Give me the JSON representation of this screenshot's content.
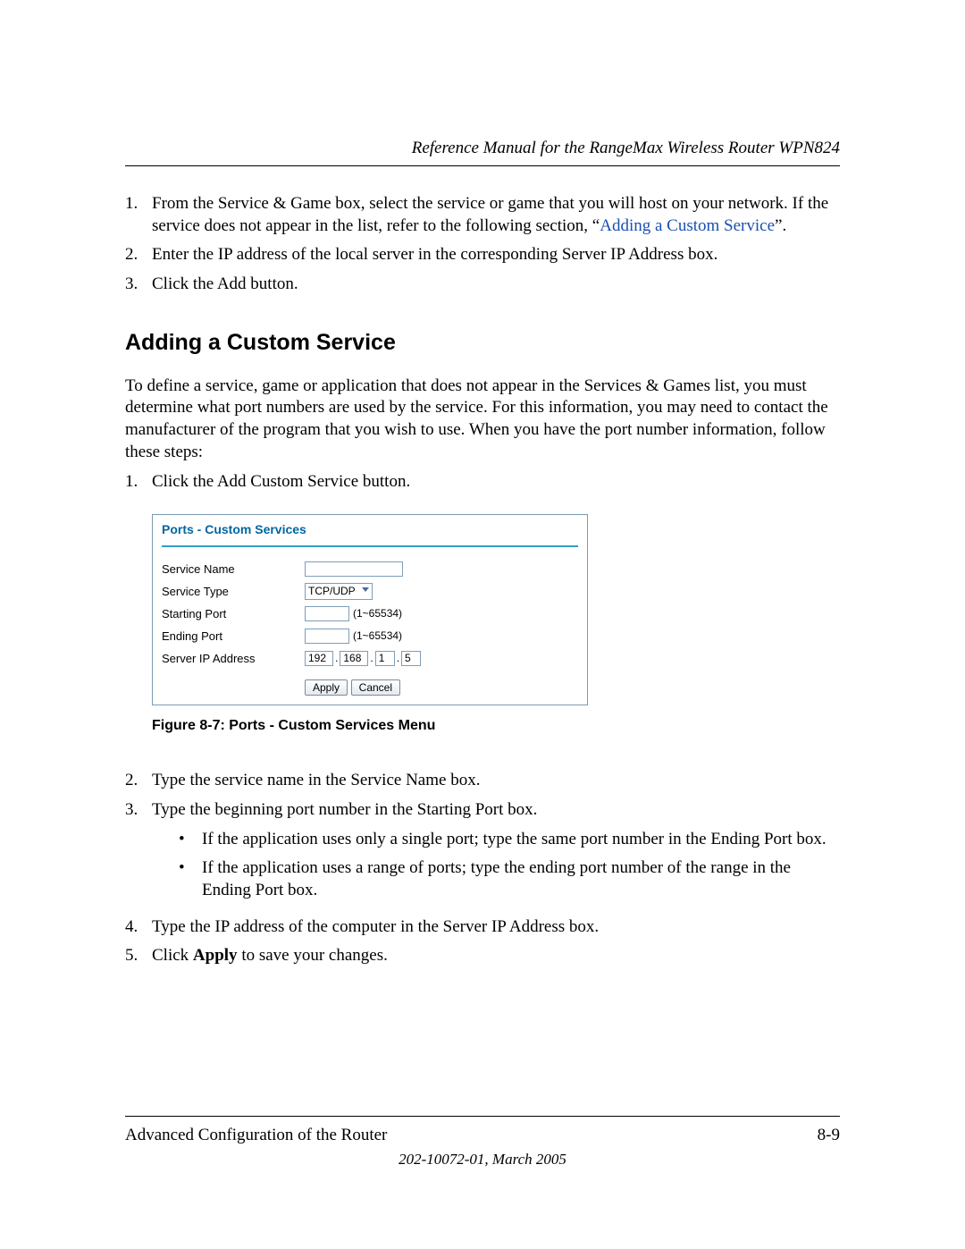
{
  "header": {
    "title": "Reference Manual for the RangeMax Wireless Router WPN824"
  },
  "list_a": {
    "item1_prefix": "From the Service & Game box, select the service or game that you will host on your network. If the service does not appear in the list, refer to the following section, “",
    "item1_link": "Adding a Custom Service",
    "item1_suffix": "”.",
    "item2": "Enter the IP address of the local server in the corresponding Server IP Address box.",
    "item3": "Click the Add button."
  },
  "section_heading": "Adding a Custom Service",
  "para1": "To define a service, game or application that does not appear in the Services & Games list, you must determine what port numbers are used by the service. For this information, you may need to contact the manufacturer of the program that you wish to use. When you have the port number information, follow these steps:",
  "list_b": {
    "item1": "Click the Add Custom Service button."
  },
  "figure": {
    "panel_title": "Ports - Custom Services",
    "labels": {
      "service_name": "Service Name",
      "service_type": "Service Type",
      "starting_port": "Starting Port",
      "ending_port": "Ending Port",
      "server_ip": "Server IP Address"
    },
    "values": {
      "service_name": "",
      "service_type": "TCP/UDP",
      "starting_port": "",
      "ending_port": "",
      "port_hint": "(1~65534)",
      "ip": {
        "a": "192",
        "b": "168",
        "c": "1",
        "d": "5"
      }
    },
    "buttons": {
      "apply": "Apply",
      "cancel": "Cancel"
    },
    "caption": "Figure 8-7:  Ports - Custom Services Menu"
  },
  "list_c": {
    "item2": "Type the service name in the Service Name box.",
    "item3": "Type the beginning port number in the Starting Port box.",
    "bullet1": "If the application uses only a single port; type the same port number in the Ending Port box.",
    "bullet2": "If the application uses a range of ports; type the ending port number of the range in the Ending Port box.",
    "item4": "Type the IP address of the computer in the Server IP Address box.",
    "item5_a": "Click ",
    "item5_bold": "Apply",
    "item5_b": " to save your changes."
  },
  "footer": {
    "left": "Advanced Configuration of the Router",
    "right": "8-9",
    "sub": "202-10072-01, March 2005"
  }
}
